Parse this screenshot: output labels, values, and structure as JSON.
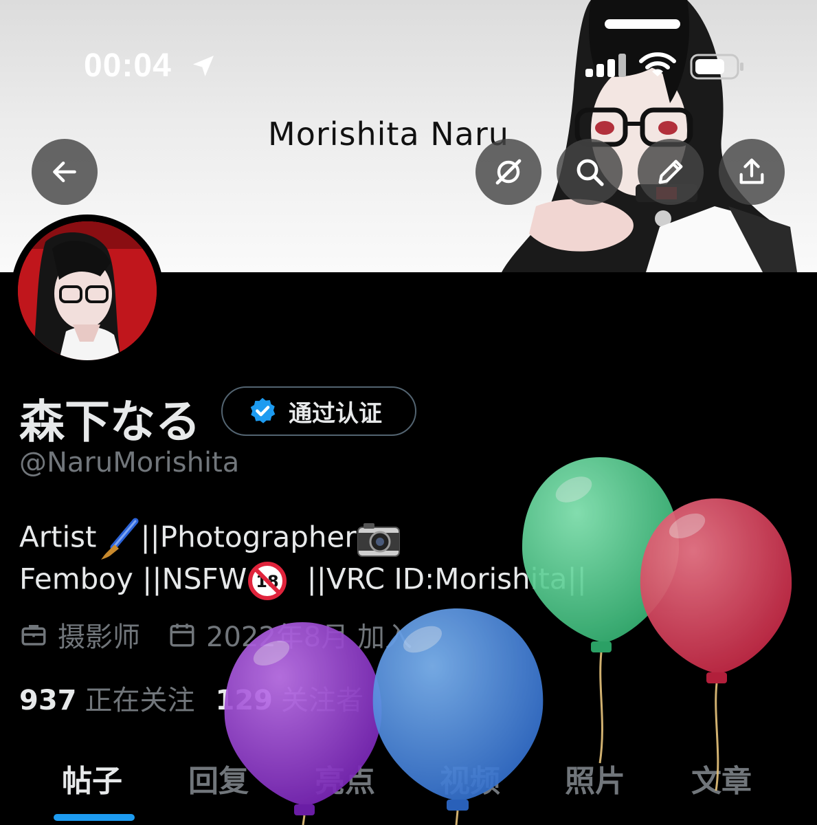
{
  "status_bar": {
    "time": "00:04"
  },
  "banner": {
    "title": "Morishita Naru"
  },
  "profile": {
    "display_name": "森下なる",
    "verified_label": "通过认证",
    "handle": "@NaruMorishita",
    "bio_line1_a": "Artist",
    "bio_line1_b": "||Photographer",
    "bio_line2_a": "Femboy ||NSFW",
    "bio_line2_b": "||VRC ID:Morishita||",
    "profession": "摄影师",
    "joined": "2022年8月 加入",
    "following_count": "937",
    "following_label": "正在关注",
    "followers_count": "129",
    "followers_label": "关注者"
  },
  "tabs": [
    {
      "label": "帖子",
      "active": true
    },
    {
      "label": "回复"
    },
    {
      "label": "亮点"
    },
    {
      "label": "视频"
    },
    {
      "label": "照片"
    },
    {
      "label": "文章"
    }
  ],
  "icons": {
    "back": "back-arrow-icon",
    "grok": "grok-icon",
    "search": "search-icon",
    "edit": "pencil-icon",
    "share": "share-icon",
    "verified": "verified-badge-icon",
    "profession": "briefcase-icon",
    "joined": "calendar-icon"
  },
  "colors": {
    "accent": "#1d9bf0",
    "muted": "#71767b",
    "text": "#e7e9ea",
    "balloon_purple": "#8e2fc4",
    "balloon_blue": "#3a7fd6",
    "balloon_green": "#4cc98a",
    "balloon_red": "#d83a54"
  }
}
